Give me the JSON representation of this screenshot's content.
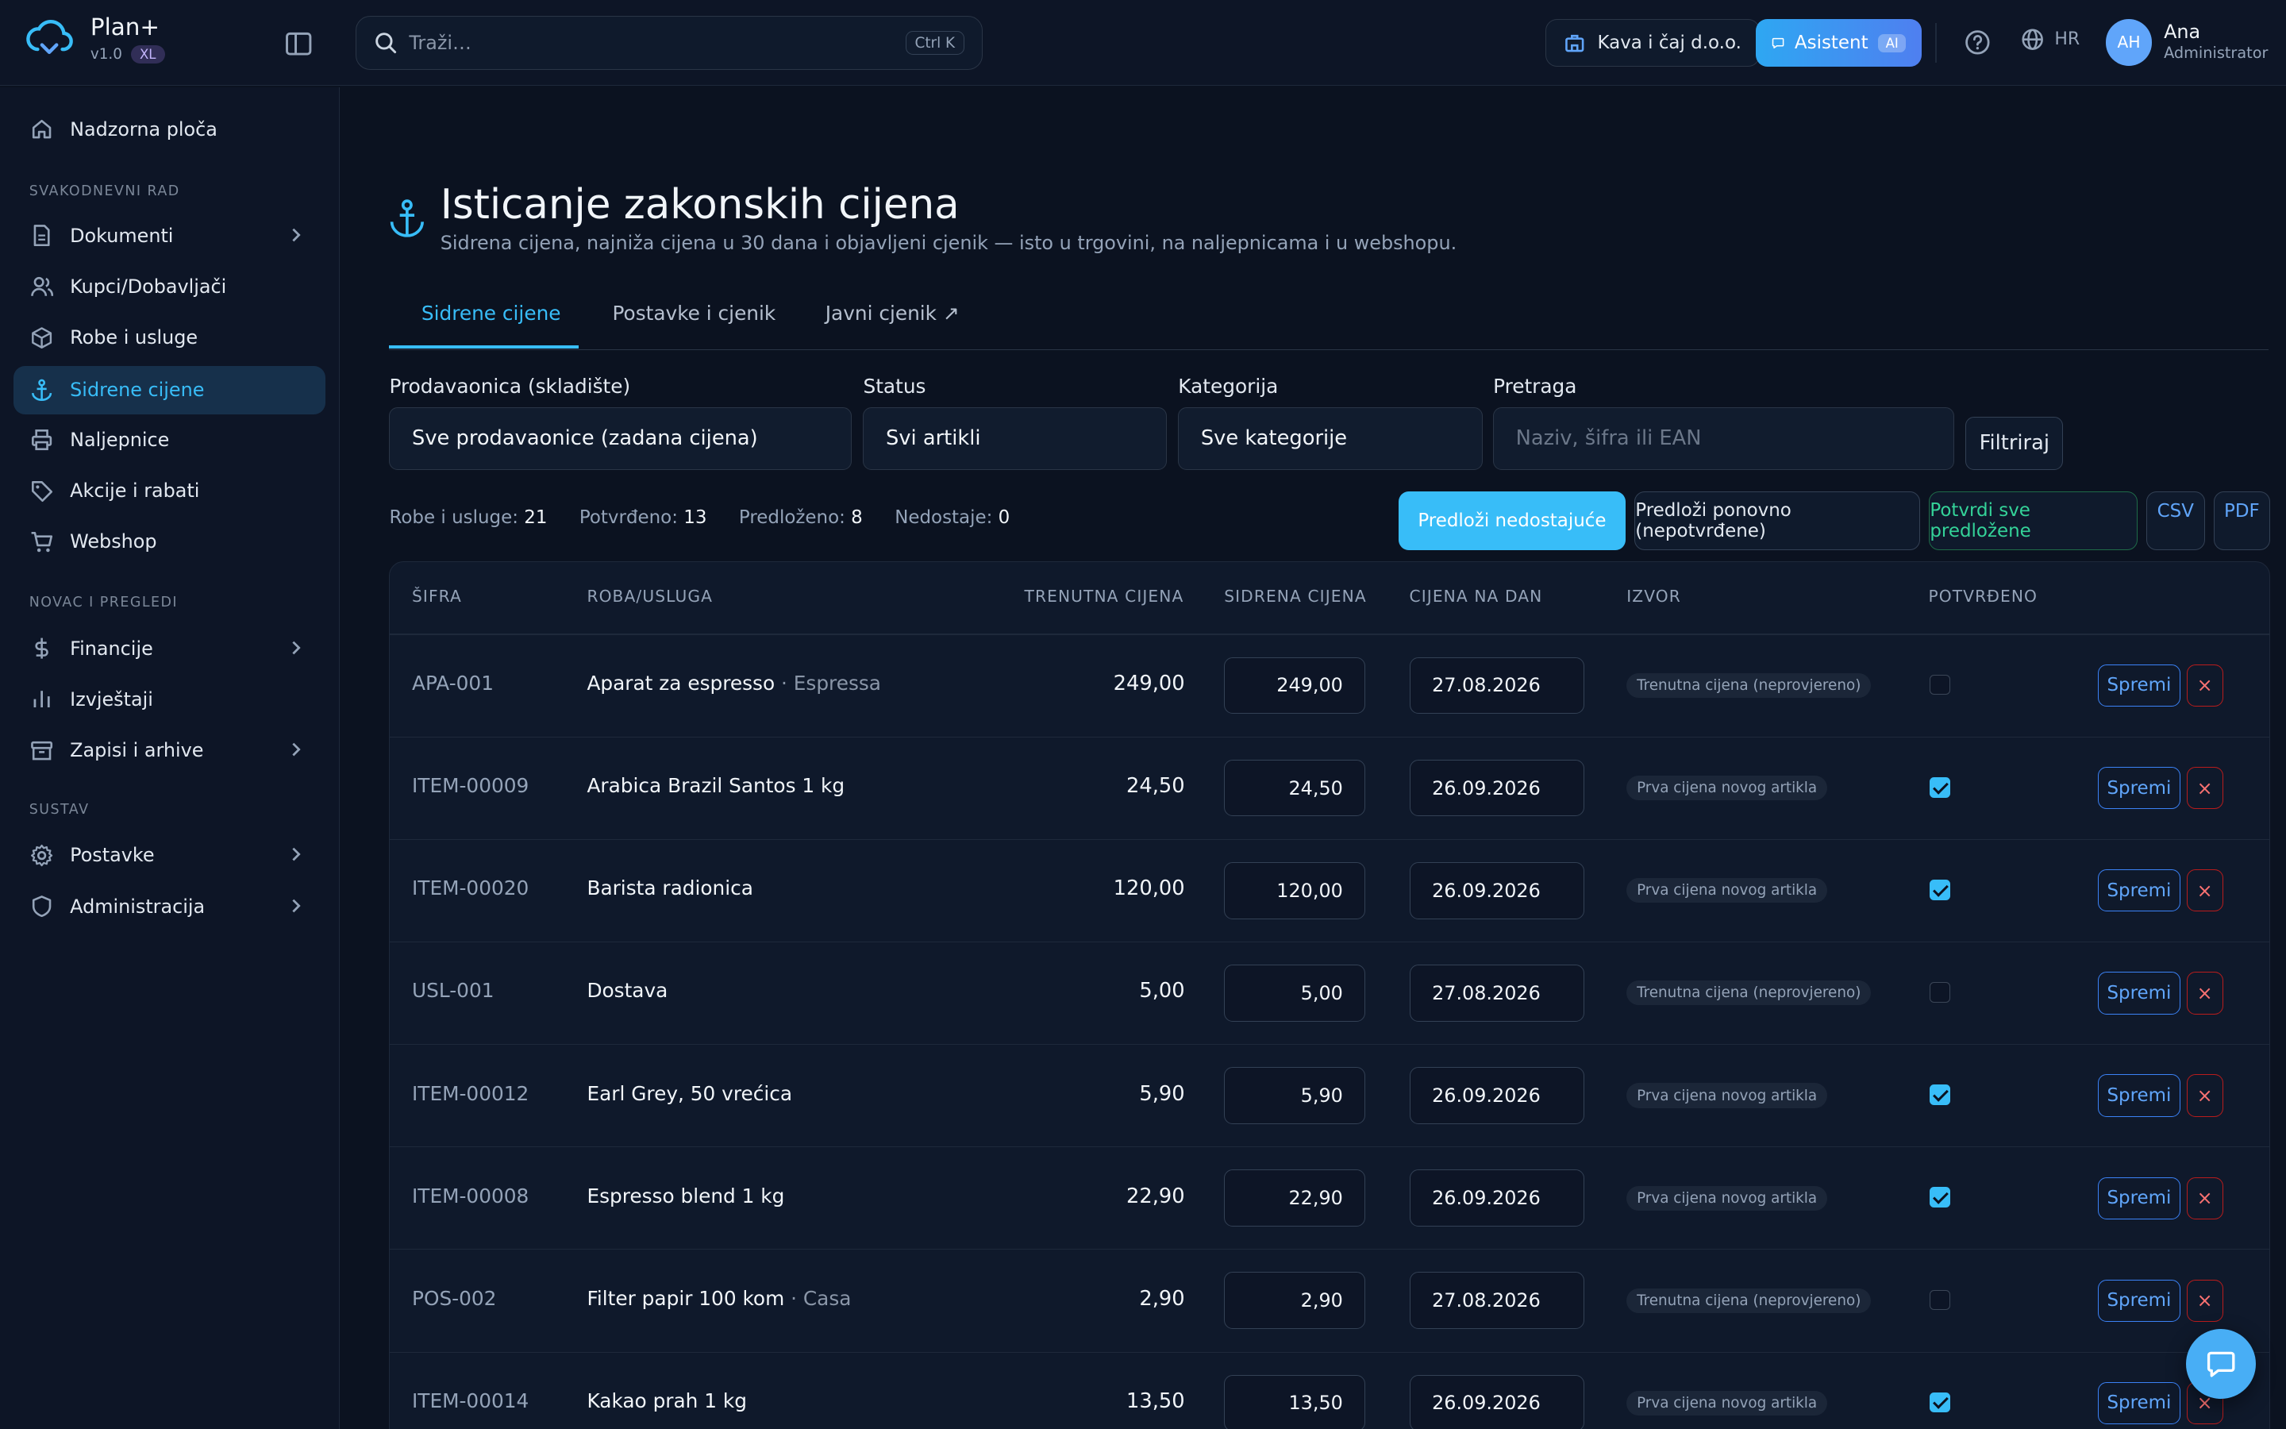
{
  "brand": {
    "name": "Plan+",
    "version": "v1.0",
    "plan_badge": "XL"
  },
  "search": {
    "placeholder": "Traži…",
    "shortcut": "Ctrl K"
  },
  "header": {
    "company": "Kava i čaj d.o.o.",
    "assistant_label": "Asistent",
    "assistant_badge": "AI",
    "language": "HR",
    "user_initials": "AH",
    "user_name": "Ana",
    "user_role": "Administrator"
  },
  "sidebar": {
    "home": "Nadzorna ploča",
    "sections": [
      "SVAKODNEVNI RAD",
      "NOVAC I PREGLEDI",
      "SUSTAV"
    ],
    "items": [
      "Dokumenti",
      "Kupci/Dobavljači",
      "Robe i usluge",
      "Sidrene cijene",
      "Naljepnice",
      "Akcije i rabati",
      "Webshop",
      "Financije",
      "Izvještaji",
      "Zapisi i arhive",
      "Postavke",
      "Administracija"
    ]
  },
  "page": {
    "title": "Isticanje zakonskih cijena",
    "subtitle": "Sidrena cijena, najniža cijena u 30 dana i objavljeni cjenik — isto u trgovini, na naljepnicama i u webshopu."
  },
  "tabs": [
    "Sidrene cijene",
    "Postavke i cjenik",
    "Javni cjenik ↗"
  ],
  "filters": {
    "store_label": "Prodavaonica (skladište)",
    "store_value": "Sve prodavaonice (zadana cijena)",
    "status_label": "Status",
    "status_value": "Svi artikli",
    "category_label": "Kategorija",
    "category_value": "Sve kategorije",
    "search_label": "Pretraga",
    "search_placeholder": "Naziv, šifra ili EAN",
    "filter_button": "Filtriraj"
  },
  "stats": {
    "goods_label": "Robe i usluge:",
    "goods_value": "21",
    "confirmed_label": "Potvrđeno:",
    "confirmed_value": "13",
    "proposed_label": "Predloženo:",
    "proposed_value": "8",
    "missing_label": "Nedostaje:",
    "missing_value": "0"
  },
  "actions": {
    "propose_missing": "Predloži nedostajuće",
    "repropose": "Predloži ponovno (nepotvrđene)",
    "confirm_all": "Potvrdi sve predložene",
    "csv": "CSV",
    "pdf": "PDF"
  },
  "table": {
    "headers": [
      "ŠIFRA",
      "ROBA/USLUGA",
      "TRENUTNA CIJENA",
      "SIDRENA CIJENA",
      "CIJENA NA DAN",
      "IZVOR",
      "POTVRĐENO"
    ],
    "save_label": "Spremi",
    "delete_label": "×",
    "rows": [
      {
        "code": "APA-001",
        "name": "Aparat za espresso",
        "category": "· Espressa",
        "price": "249,00",
        "anchor": "249,00",
        "date": "27.08.2026",
        "source": "Trenutna cijena (neprovjereno)",
        "confirmed": false
      },
      {
        "code": "ITEM-00009",
        "name": "Arabica Brazil Santos 1 kg",
        "category": "",
        "price": "24,50",
        "anchor": "24,50",
        "date": "26.09.2026",
        "source": "Prva cijena novog artikla",
        "confirmed": true
      },
      {
        "code": "ITEM-00020",
        "name": "Barista radionica",
        "category": "",
        "price": "120,00",
        "anchor": "120,00",
        "date": "26.09.2026",
        "source": "Prva cijena novog artikla",
        "confirmed": true
      },
      {
        "code": "USL-001",
        "name": "Dostava",
        "category": "",
        "price": "5,00",
        "anchor": "5,00",
        "date": "27.08.2026",
        "source": "Trenutna cijena (neprovjereno)",
        "confirmed": false
      },
      {
        "code": "ITEM-00012",
        "name": "Earl Grey, 50 vrećica",
        "category": "",
        "price": "5,90",
        "anchor": "5,90",
        "date": "26.09.2026",
        "source": "Prva cijena novog artikla",
        "confirmed": true
      },
      {
        "code": "ITEM-00008",
        "name": "Espresso blend 1 kg",
        "category": "",
        "price": "22,90",
        "anchor": "22,90",
        "date": "26.09.2026",
        "source": "Prva cijena novog artikla",
        "confirmed": true
      },
      {
        "code": "POS-002",
        "name": "Filter papir 100 kom",
        "category": "· Casa",
        "price": "2,90",
        "anchor": "2,90",
        "date": "27.08.2026",
        "source": "Trenutna cijena (neprovjereno)",
        "confirmed": false
      },
      {
        "code": "ITEM-00014",
        "name": "Kakao prah 1 kg",
        "category": "",
        "price": "13,50",
        "anchor": "13,50",
        "date": "26.09.2026",
        "source": "Prva cijena novog artikla",
        "confirmed": true
      }
    ]
  },
  "colors": {
    "accent": "#38bdf8",
    "background": "#0b1220",
    "panel": "#0d1526",
    "danger": "#f87171",
    "success": "#34d399"
  }
}
